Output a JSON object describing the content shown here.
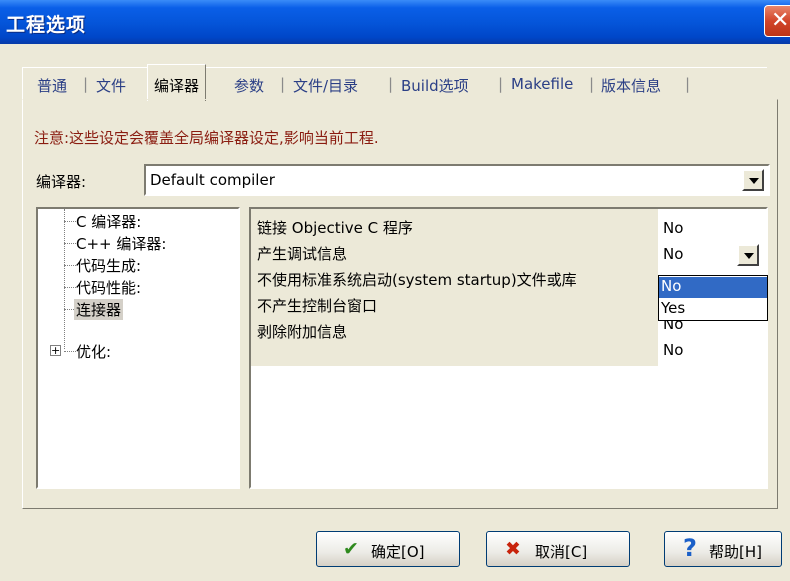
{
  "window": {
    "title": "工程选项",
    "close_glyph": "✕"
  },
  "tabs": [
    {
      "label": "普通"
    },
    {
      "label": "文件"
    },
    {
      "label": "编译器",
      "active": true
    },
    {
      "label": "参数"
    },
    {
      "label": "文件/目录"
    },
    {
      "label": "Build选项"
    },
    {
      "label": "Makefile"
    },
    {
      "label": "版本信息"
    }
  ],
  "tab_separator": "|",
  "notice": "注意:这些设定会覆盖全局编译器设定,影响当前工程.",
  "compiler": {
    "label": "编译器:",
    "value": "Default compiler"
  },
  "tree": {
    "items": [
      {
        "label": "C 编译器:"
      },
      {
        "label": "C++ 编译器:"
      },
      {
        "label": "代码生成:"
      },
      {
        "label": "代码性能:"
      },
      {
        "label": "连接器",
        "selected": true
      },
      {
        "label": "优化:",
        "expander": "+"
      }
    ]
  },
  "grid": {
    "rows": [
      {
        "name": "链接 Objective C 程序",
        "value": "No"
      },
      {
        "name": "产生调试信息",
        "value": "No"
      },
      {
        "name": "不使用标准系统启动(system startup)文件或库",
        "value": ""
      },
      {
        "name": "不产生控制台窗口",
        "value": "No"
      },
      {
        "name": "剥除附加信息",
        "value": "No"
      }
    ],
    "dropdown_options": [
      "No",
      "Yes"
    ],
    "dropdown_highlight": "No"
  },
  "buttons": {
    "ok": {
      "label": "确定[O]",
      "icon": "check-icon",
      "glyph": "✔",
      "color": "#2f8a1e"
    },
    "cancel": {
      "label": "取消[C]",
      "icon": "x-icon",
      "glyph": "✖",
      "color": "#c8240c"
    },
    "help": {
      "label": "帮助[H]",
      "icon": "question-icon",
      "glyph": "?",
      "color": "#1a5fc8"
    }
  },
  "colors": {
    "title_bar": "#0454d8",
    "notice_text": "#8a1c10",
    "highlight": "#316ac5"
  }
}
